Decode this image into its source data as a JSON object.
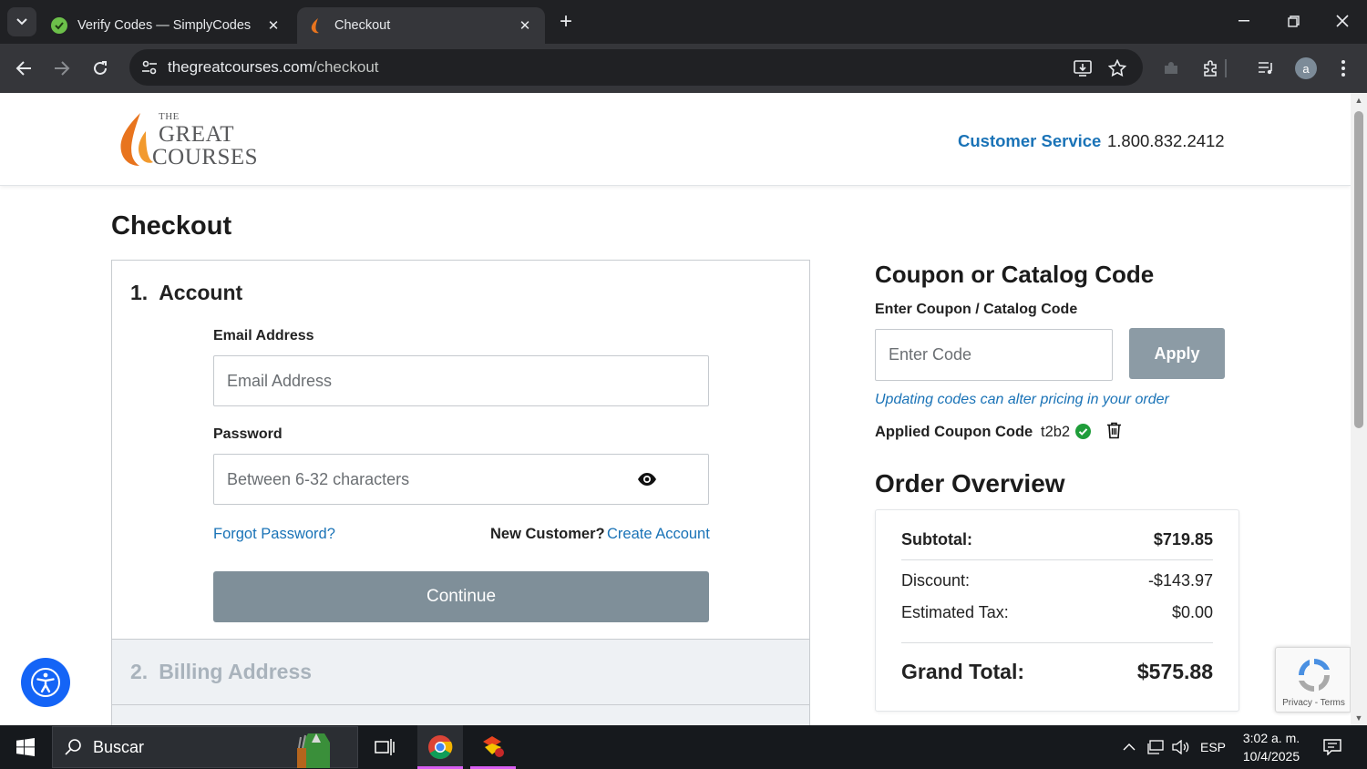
{
  "browser": {
    "tabs": [
      {
        "title": "Verify Codes — SimplyCodes",
        "active": false
      },
      {
        "title": "Checkout",
        "active": true
      }
    ],
    "url_domain": "thegreatcourses.com",
    "url_path": "/checkout",
    "profile_initial": "a"
  },
  "header": {
    "logo_the": "THE",
    "logo_great": "GREAT",
    "logo_courses": "COURSES",
    "customer_service": "Customer Service",
    "phone": "1.800.832.2412"
  },
  "checkout": {
    "title": "Checkout",
    "account": {
      "number": "1.",
      "title": "Account",
      "email_label": "Email Address",
      "email_placeholder": "Email Address",
      "password_label": "Password",
      "password_placeholder": "Between 6-32 characters",
      "forgot_password": "Forgot Password?",
      "new_customer": "New Customer?",
      "create_account": "Create Account",
      "continue": "Continue"
    },
    "billing": {
      "number": "2.",
      "title": "Billing Address"
    }
  },
  "coupon": {
    "title": "Coupon or Catalog Code",
    "label": "Enter Coupon / Catalog Code",
    "placeholder": "Enter Code",
    "apply": "Apply",
    "note": "Updating codes can alter pricing in your order",
    "applied_label": "Applied Coupon Code",
    "applied_code": "t2b2"
  },
  "overview": {
    "title": "Order Overview",
    "subtotal_label": "Subtotal:",
    "subtotal": "$719.85",
    "discount_label": "Discount:",
    "discount": "-$143.97",
    "tax_label": "Estimated Tax:",
    "tax": "$0.00",
    "total_label": "Grand Total:",
    "total": "$575.88"
  },
  "recaptcha": {
    "text": "Privacy - Terms"
  },
  "taskbar": {
    "search_text": "Buscar",
    "language": "ESP",
    "time": "3:02 a. m.",
    "date": "10/4/2025"
  },
  "colors": {
    "brand_blue": "#1a73b7",
    "button_gray": "#7f8f99",
    "logo_orange": "#e8741e",
    "accessibility_blue": "#1464f6"
  }
}
